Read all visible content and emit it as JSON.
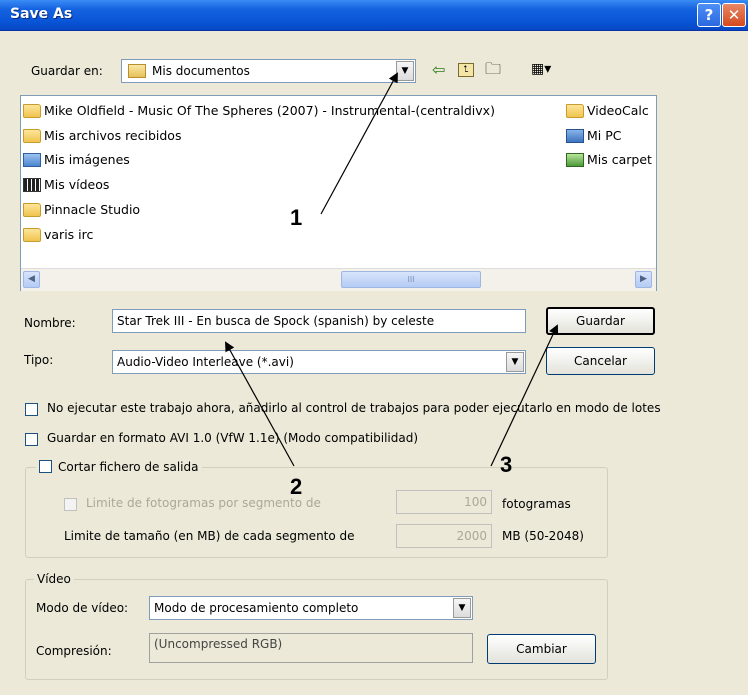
{
  "window": {
    "title": "Save As",
    "help_label": "?",
    "close_label": "✕"
  },
  "toolbar": {
    "save_in_label": "Guardar en:",
    "save_in_value": "Mis documentos",
    "icons": [
      "back-arrow-icon",
      "up-folder-icon",
      "new-folder-icon",
      "view-menu-icon"
    ]
  },
  "file_list": {
    "items": [
      {
        "label": "Mike Oldfield - Music Of The Spheres (2007) - Instrumental-(centraldivx)",
        "icon": "folder-icon"
      },
      {
        "label": "Mis archivos recibidos",
        "icon": "folder-icon"
      },
      {
        "label": "Mis imágenes",
        "icon": "pictures-folder-icon"
      },
      {
        "label": "Mis vídeos",
        "icon": "videos-folder-icon"
      },
      {
        "label": "Pinnacle Studio",
        "icon": "folder-icon"
      },
      {
        "label": "varis irc",
        "icon": "folder-icon"
      },
      {
        "label": "VideoCalc",
        "icon": "folder-icon"
      },
      {
        "label": "Mi PC",
        "icon": "my-computer-icon"
      },
      {
        "label": "Mis carpet",
        "icon": "network-places-icon"
      }
    ],
    "scroll_thumb": "III"
  },
  "form": {
    "name_label": "Nombre:",
    "name_value": "Star Trek III - En busca de Spock (spanish) by celeste",
    "type_label": "Tipo:",
    "type_value": "Audio-Video Interleave (*.avi)",
    "save_button": "Guardar",
    "cancel_button": "Cancelar"
  },
  "options": {
    "batch_checkbox": "No ejecutar este trabajo ahora, añadirlo al control de trabajos para poder ejecutarlo en modo de lotes",
    "avi10_checkbox": "Guardar en formato AVI 1.0 (VfW 1.1e) (Modo compatibilidad)",
    "split_checkbox": "Cortar fichero de salida",
    "frames_limit_label": "Limite de fotogramas por segmento de",
    "frames_limit_value": "100",
    "frames_unit": "fotogramas",
    "size_limit_label": "Limite de tamaño (en MB) de cada segmento de",
    "size_limit_value": "2000",
    "size_unit": "MB (50-2048)"
  },
  "video": {
    "group_label": "Vídeo",
    "mode_label": "Modo de vídeo:",
    "mode_value": "Modo de procesamiento completo",
    "compression_label": "Compresión:",
    "compression_value": "(Uncompressed RGB)",
    "change_button": "Cambiar"
  },
  "annotations": {
    "n1": "1",
    "n2": "2",
    "n3": "3"
  }
}
